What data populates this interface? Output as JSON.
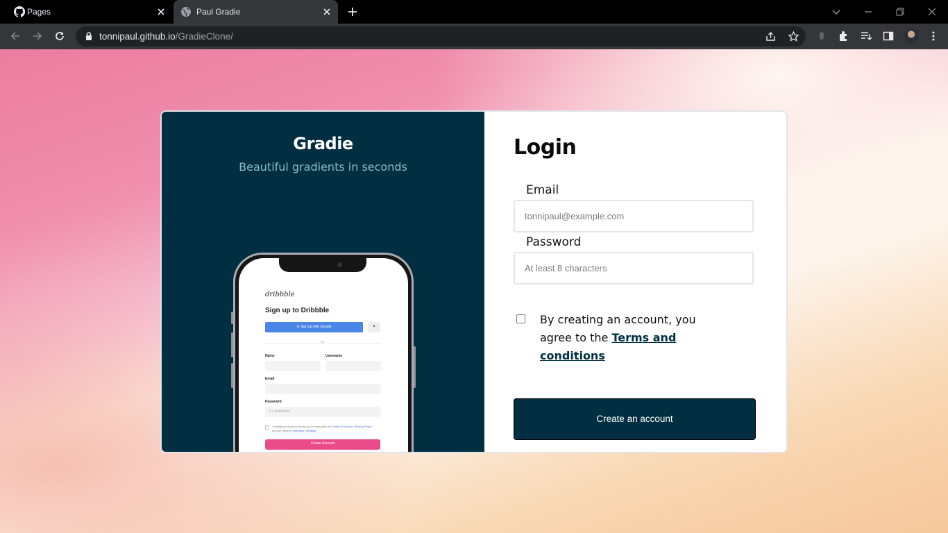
{
  "browser": {
    "tabs": [
      {
        "title": "Pages",
        "favicon": "github-icon",
        "active": false
      },
      {
        "title": "Paul Gradie",
        "favicon": "globe-icon",
        "active": true
      }
    ],
    "url": {
      "host": "tonnipaul.github.io",
      "path": "/GradieClone/"
    }
  },
  "hero": {
    "brand": "Gradie",
    "tagline": "Beautiful gradients in seconds",
    "bg_color": "#012f41"
  },
  "mockup": {
    "logo": "dribbble",
    "title": "Sign up to Dribbble",
    "google_button": "G  Sign up with Google",
    "twitter_icon": "twitter-icon",
    "or": "Or",
    "name_label": "Name",
    "username_label": "Username",
    "email_label": "Email",
    "password_label": "Password",
    "password_placeholder": "6+ characters",
    "terms_pre": "Creating an account means you're okay with our ",
    "terms_link1": "Terms of Service, Privacy Policy",
    "terms_mid": ", and our default ",
    "terms_link2": "Notification Settings",
    "terms_end": ".",
    "create_button": "Create Account"
  },
  "form": {
    "title": "Login",
    "email_label": "Email",
    "email_placeholder": "tonnipaul@example.com",
    "password_label": "Password",
    "password_placeholder": "At least 8 characters",
    "consent_text": "By creating an account, you agree to the ",
    "terms_link": "Terms and conditions",
    "submit_label": "Create an account",
    "accent_color": "#012f41"
  }
}
